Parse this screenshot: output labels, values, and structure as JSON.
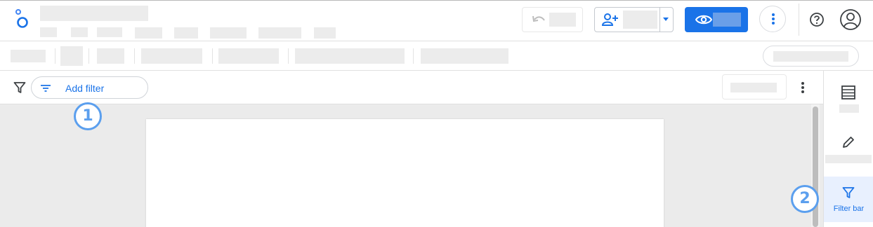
{
  "filter_row": {
    "add_filter_label": "Add filter"
  },
  "right_panel": {
    "items": [
      {
        "id": "data",
        "icon": "table-icon"
      },
      {
        "id": "edit",
        "icon": "pencil-icon"
      },
      {
        "id": "filter-bar",
        "icon": "filter-icon",
        "label": "Filter bar",
        "active": true
      }
    ]
  },
  "callouts": [
    "1",
    "2"
  ],
  "colors": {
    "accent": "#1a73e8",
    "callout": "#5b9fee",
    "active_bg": "#e8f0fe"
  }
}
